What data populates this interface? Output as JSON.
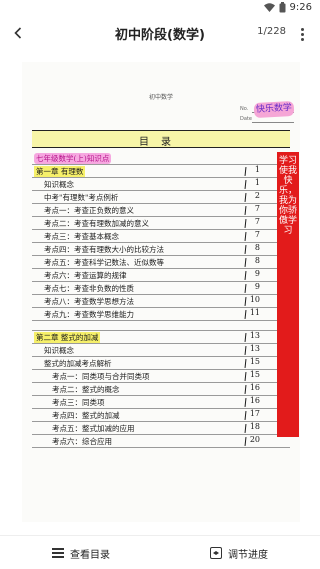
{
  "statusbar": {
    "time": "9:26"
  },
  "header": {
    "title": "初中阶段(数学)",
    "page_counter": "1/228"
  },
  "doc": {
    "course": "初中数学",
    "no_label": "No.",
    "date_label": "Date",
    "stamp": "快乐数学",
    "toc_title": "目录",
    "rows": [
      {
        "text": "七年级数学(上)知识点",
        "page": "",
        "style": "pink",
        "indent": 0
      },
      {
        "text": "第一章  有理数",
        "page": "1",
        "style": "yellow",
        "indent": 0
      },
      {
        "text": "知识概念",
        "page": "1",
        "style": "",
        "indent": 10
      },
      {
        "text": "中考\"有理数\"考点例析",
        "page": "2",
        "style": "",
        "indent": 10
      },
      {
        "text": "考点一：考查正负数的意义",
        "page": "7",
        "style": "",
        "indent": 10
      },
      {
        "text": "考点二：考查有理数加减的意义",
        "page": "7",
        "style": "",
        "indent": 10
      },
      {
        "text": "考点三：考查基本概念",
        "page": "7",
        "style": "",
        "indent": 10
      },
      {
        "text": "考点四：考查有理数大小的比较方法",
        "page": "8",
        "style": "",
        "indent": 10
      },
      {
        "text": "考点五：考查科学记数法、近似数等",
        "page": "8",
        "style": "",
        "indent": 10
      },
      {
        "text": "考点六：考查运算的规律",
        "page": "9",
        "style": "",
        "indent": 10
      },
      {
        "text": "考点七：考查非负数的性质",
        "page": "9",
        "style": "",
        "indent": 10
      },
      {
        "text": "考点八：考查数学思想方法",
        "page": "10",
        "style": "",
        "indent": 10
      },
      {
        "text": "考点九：考查数学思维能力",
        "page": "11",
        "style": "",
        "indent": 10
      },
      {
        "text": "",
        "page": "",
        "style": "gap",
        "indent": 0
      },
      {
        "text": "第二章  整式的加减",
        "page": "13",
        "style": "yellow",
        "indent": 0
      },
      {
        "text": "知识概念",
        "page": "13",
        "style": "",
        "indent": 10
      },
      {
        "text": "整式的加减考点解析",
        "page": "15",
        "style": "",
        "indent": 10
      },
      {
        "text": "考点一：同类项与合并同类项",
        "page": "15",
        "style": "",
        "indent": 18
      },
      {
        "text": "考点二：整式的概念",
        "page": "16",
        "style": "",
        "indent": 18
      },
      {
        "text": "考点三：同类项",
        "page": "16",
        "style": "",
        "indent": 18
      },
      {
        "text": "考点四：整式的加减",
        "page": "17",
        "style": "",
        "indent": 18
      },
      {
        "text": "考点五：整式加减的应用",
        "page": "18",
        "style": "",
        "indent": 18
      },
      {
        "text": "考点六：综合应用",
        "page": "20",
        "style": "",
        "indent": 18
      }
    ],
    "ribbon_text_1": "学习使我快乐，我为你骄傲学习",
    "ribbon_text_2": "学习使我快乐，我为你骄傲学习"
  },
  "bottombar": {
    "toc_label": "查看目录",
    "adjust_label": "调节进度"
  },
  "colors": {
    "ribbon": "#e21b1b",
    "highlight_yellow": "#f6f06a",
    "highlight_pink": "#f6a8e0"
  }
}
